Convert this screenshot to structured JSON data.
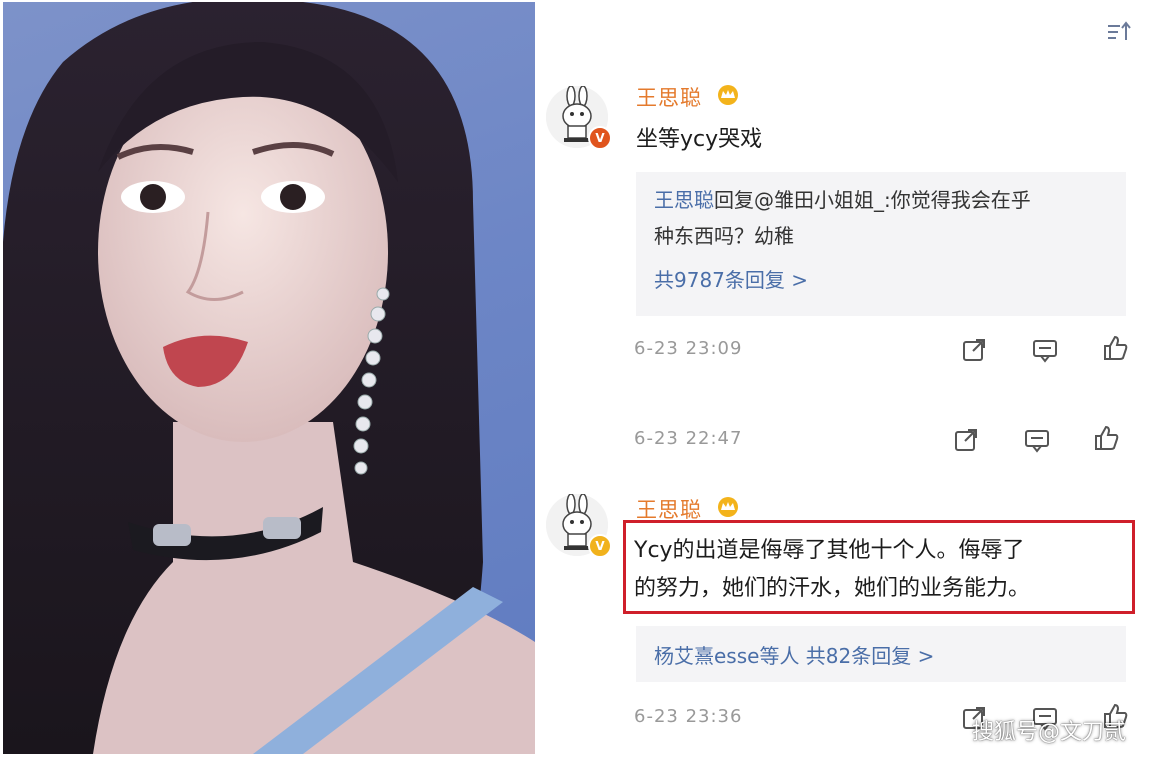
{
  "comments": [
    {
      "username": "王思聪",
      "text": "坐等ycy哭戏",
      "reply_preview_author": "王思聪",
      "reply_preview_rest": "回复@雏田小姐姐_:你觉得我会在乎",
      "reply_preview_line2": "种东西吗？幼稚",
      "reply_count": "共9787条回复 >",
      "timestamp": "6-23 23:09"
    },
    {
      "timestamp": "6-23 22:47"
    },
    {
      "username": "王思聪",
      "text_line1": "Ycy的出道是侮辱了其他十个人。侮辱了",
      "text_line2": "的努力，她们的汗水，她们的业务能力。",
      "reply_summary": "杨艾熹esse等人  共82条回复 >",
      "timestamp": "6-23 23:36"
    }
  ],
  "verified_badge": "V",
  "watermark": "搜狐号@文刀贰",
  "colors": {
    "username": "#e47a2c",
    "link": "#4a6ea8",
    "highlight": "#cf1f2a",
    "photo_bg": "#6d86c6"
  },
  "icons": [
    "sort-icon",
    "share-icon",
    "comment-icon",
    "like-icon",
    "crown-icon",
    "verified-icon"
  ]
}
